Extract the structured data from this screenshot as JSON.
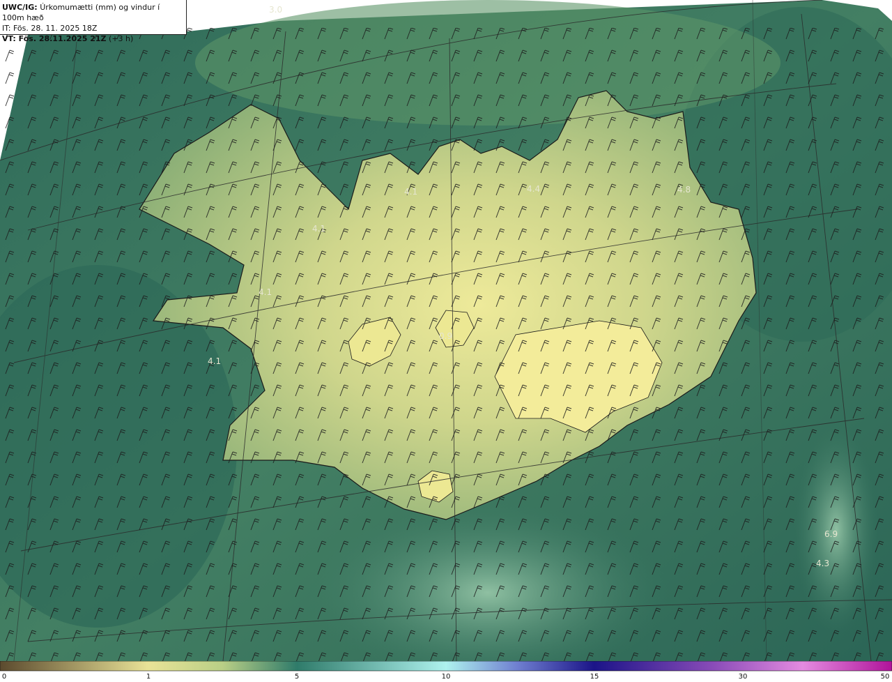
{
  "header": {
    "model_label": "UWC/IG:",
    "title": "Úrkomumætti (mm) og vindur í 100m hæð",
    "issue_time": "IT: Fös. 28. 11. 2025 18Z",
    "valid_label": "VT: Fös. 28.11.2025 21Z",
    "valid_offset": "(+3 h)"
  },
  "map_labels": [
    {
      "id": "label-1",
      "text": "3.0"
    },
    {
      "id": "label-2",
      "text": "4.1"
    },
    {
      "id": "label-3",
      "text": "4.4"
    },
    {
      "id": "label-4",
      "text": "4.8"
    },
    {
      "id": "label-5",
      "text": "4.1"
    },
    {
      "id": "label-6",
      "text": "4.1"
    },
    {
      "id": "label-7",
      "text": "4.1"
    },
    {
      "id": "label-8",
      "text": "0.9"
    },
    {
      "id": "label-9",
      "text": "6.9"
    },
    {
      "id": "label-10",
      "text": "4.3"
    }
  ],
  "colorbar": {
    "ticks": [
      "0",
      "1",
      "5",
      "10",
      "15",
      "30",
      "50"
    ],
    "colors": [
      "#5b4a2e",
      "#cfc27a",
      "#f3ec9a",
      "#2f7b6a",
      "#aef2ee",
      "#1b1488",
      "#d85fd0",
      "#b0139a"
    ]
  },
  "colors": {
    "sea_dark": "#2f6b5a",
    "sea_mid": "#3e7f63",
    "land_light": "#d9dd8e",
    "land_mid": "#b8c97f",
    "coast": "#1a1a1a"
  }
}
